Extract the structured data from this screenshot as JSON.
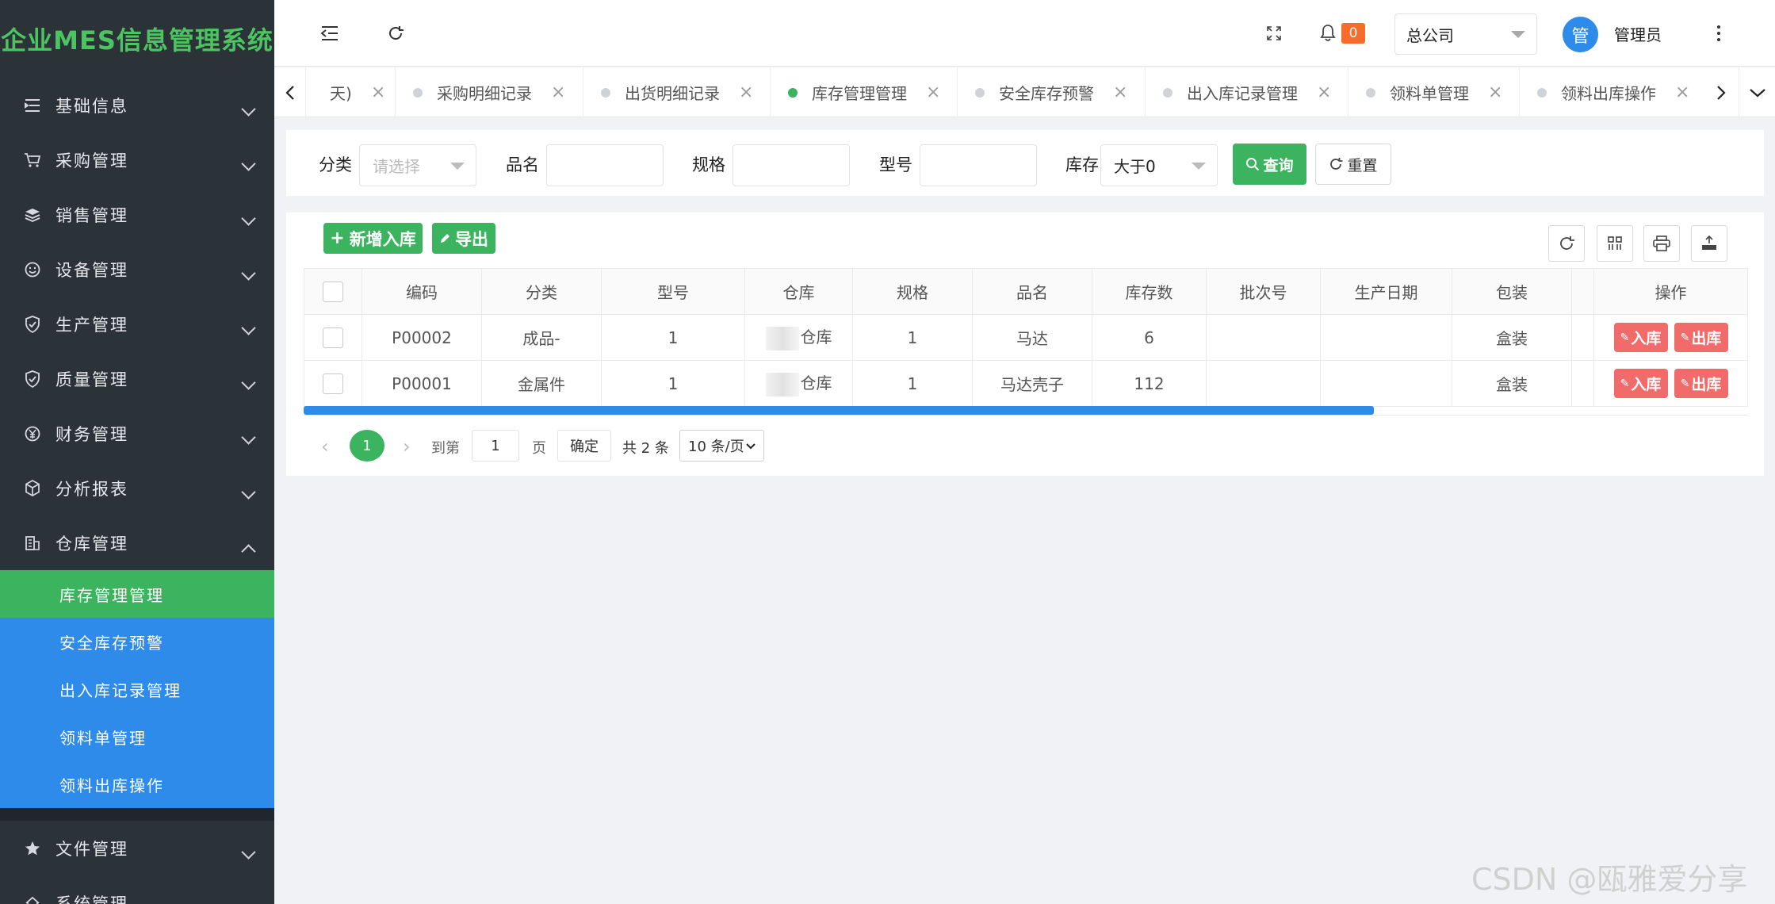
{
  "app": {
    "title": "企业MES信息管理系统"
  },
  "sidebar": {
    "items": [
      {
        "label": "基础信息",
        "icon": "list-icon"
      },
      {
        "label": "采购管理",
        "icon": "cart-icon"
      },
      {
        "label": "销售管理",
        "icon": "layers-icon"
      },
      {
        "label": "设备管理",
        "icon": "smile-icon"
      },
      {
        "label": "生产管理",
        "icon": "shield-icon"
      },
      {
        "label": "质量管理",
        "icon": "shield-icon"
      },
      {
        "label": "财务管理",
        "icon": "yen-icon"
      },
      {
        "label": "分析报表",
        "icon": "cube-icon"
      },
      {
        "label": "仓库管理",
        "icon": "building-icon"
      }
    ],
    "submenu": [
      {
        "label": "库存管理管理"
      },
      {
        "label": "安全库存预警"
      },
      {
        "label": "出入库记录管理"
      },
      {
        "label": "领料单管理"
      },
      {
        "label": "领料出库操作"
      }
    ],
    "after_items": [
      {
        "label": "文件管理",
        "icon": "star-icon"
      },
      {
        "label": "系统管理",
        "icon": "home-icon"
      }
    ]
  },
  "header": {
    "notification_count": "0",
    "company": "总公司",
    "avatar_text": "管",
    "username": "管理员"
  },
  "tabs": [
    {
      "label": "天)"
    },
    {
      "label": "采购明细记录"
    },
    {
      "label": "出货明细记录"
    },
    {
      "label": "库存管理管理"
    },
    {
      "label": "安全库存预警"
    },
    {
      "label": "出入库记录管理"
    },
    {
      "label": "领料单管理"
    },
    {
      "label": "领料出库操作"
    }
  ],
  "filters": {
    "category_label": "分类",
    "category_placeholder": "请选择",
    "name_label": "品名",
    "spec_label": "规格",
    "model_label": "型号",
    "stock_label": "库存",
    "stock_value": "大于0",
    "query_button": "查询",
    "reset_button": "重置"
  },
  "toolbar": {
    "add_button": "新增入库",
    "export_button": "导出"
  },
  "table": {
    "columns": [
      "编码",
      "分类",
      "型号",
      "仓库",
      "规格",
      "品名",
      "库存数",
      "批次号",
      "生产日期",
      "包装",
      "操作"
    ],
    "rows": [
      {
        "code": "P00002",
        "category": "成品-",
        "model": "1",
        "warehouse": "仓库",
        "spec": "1",
        "name": "马达",
        "stock": "6",
        "batch": "",
        "date": "",
        "pack": "盒装"
      },
      {
        "code": "P00001",
        "category": "金属件",
        "model": "1",
        "warehouse": "仓库",
        "spec": "1",
        "name": "马达壳子",
        "stock": "112",
        "batch": "",
        "date": "",
        "pack": "盒装"
      }
    ],
    "in_button": "入库",
    "out_button": "出库"
  },
  "pagination": {
    "current": "1",
    "goto_label": "到第",
    "page_input": "1",
    "page_unit": "页",
    "confirm": "确定",
    "total": "共 2 条",
    "page_size": "10 条/页"
  },
  "watermark": "CSDN @瓯雅爱分享",
  "colors": {
    "sidebar": "#2b3238",
    "submenu": "#2f8bea",
    "active": "#3bb35f",
    "danger": "#f26b6b"
  }
}
